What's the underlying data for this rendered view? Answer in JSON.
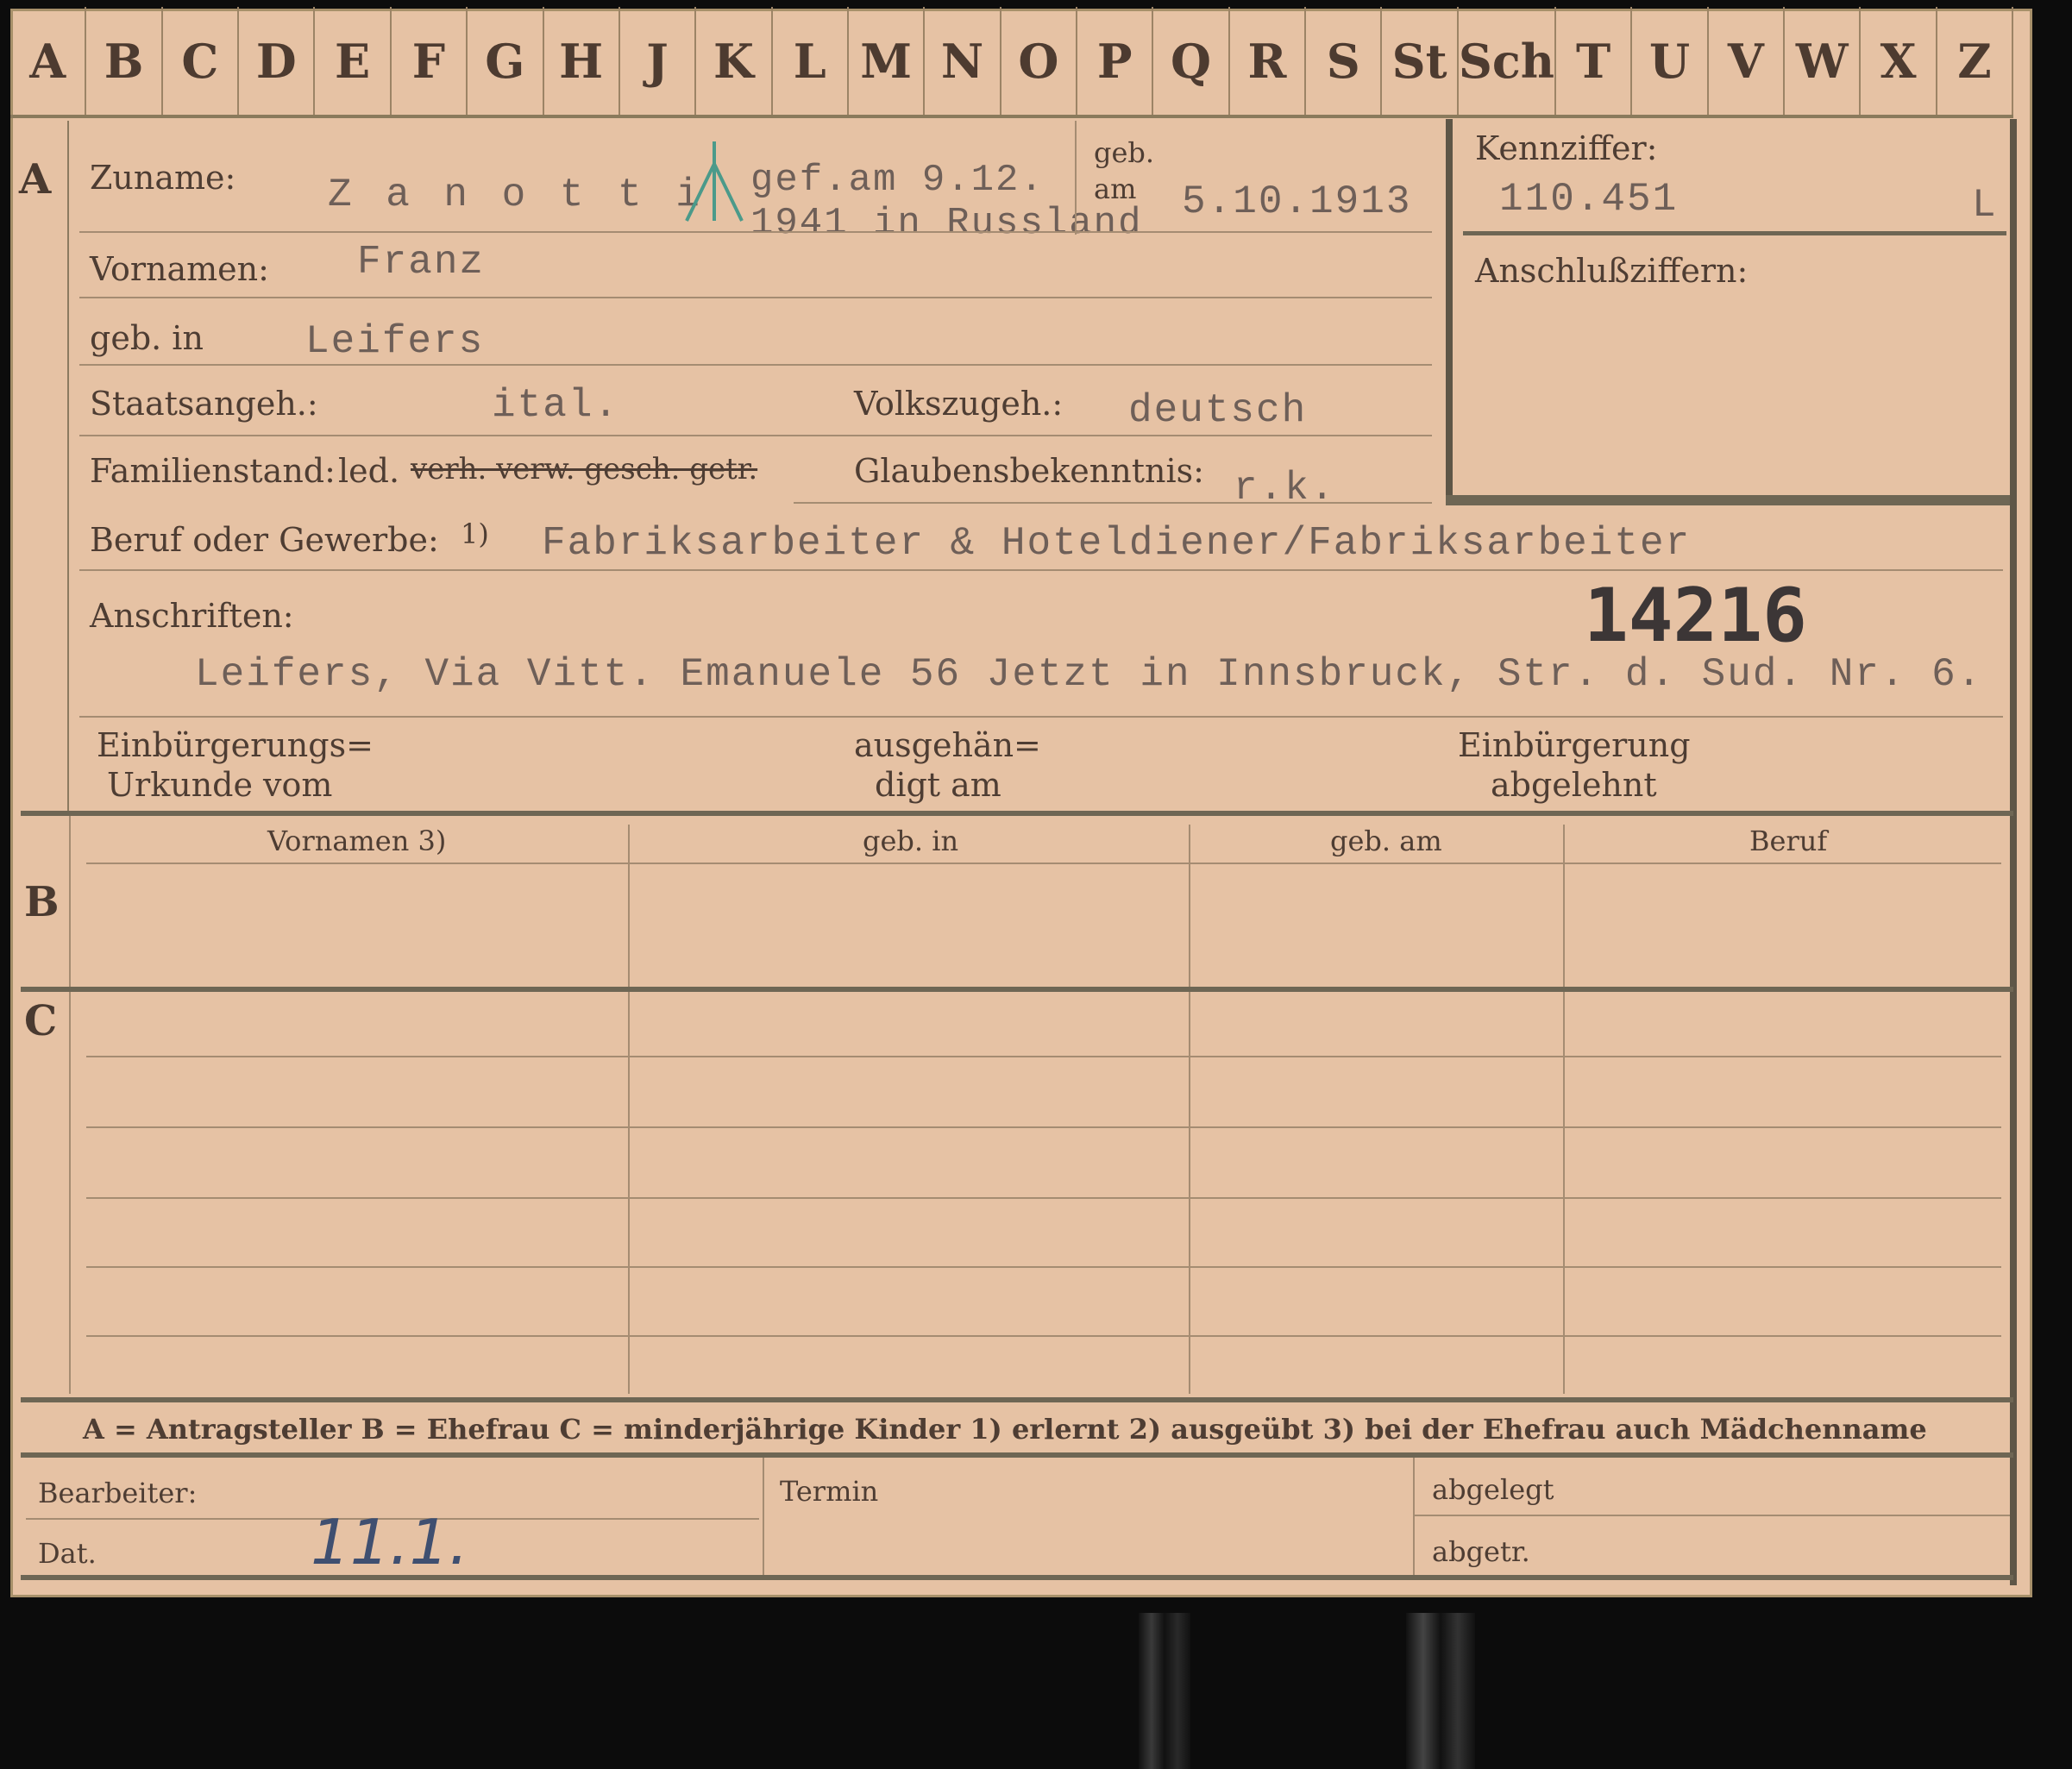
{
  "tabs": [
    "A",
    "B",
    "C",
    "D",
    "E",
    "F",
    "G",
    "H",
    "J",
    "K",
    "L",
    "M",
    "N",
    "O",
    "P",
    "Q",
    "R",
    "S",
    "St",
    "Sch",
    "T",
    "U",
    "V",
    "W",
    "X",
    "Z"
  ],
  "section_a": {
    "letter": "A",
    "zuname_label": "Zuname:",
    "zuname_value": "Z a n o t t i",
    "gefallen_1": "gef.am 9.12.",
    "gefallen_2": "1941 in Russland",
    "geb_am_label_1": "geb.",
    "geb_am_label_2": "am",
    "geb_am_value": "5.10.1913",
    "kennziffer_label": "Kennziffer:",
    "kennziffer_value": "110.451",
    "kennziffer_mark": "L",
    "anschluss_label": "Anschlußziffern:",
    "vornamen_label": "Vornamen:",
    "vornamen_value": "Franz",
    "geb_in_label": "geb. in",
    "geb_in_value": "Leifers",
    "staat_label": "Staatsangeh.:",
    "staat_value": "ital.",
    "volk_label": "Volkszugeh.:",
    "volk_value": "deutsch",
    "familienstand_label": "Familienstand:",
    "familienstand_value": "led.",
    "familienstand_struck": "verh. verw. gesch. getr.",
    "glaube_label": "Glaubensbekenntnis:",
    "glaube_value": "r.k.",
    "beruf_label": "Beruf oder Gewerbe:",
    "beruf_note": "1)",
    "beruf_value": "Fabriksarbeiter & Hoteldiener/Fabriksarbeiter",
    "anschriften_label": "Anschriften:",
    "stamp_number": "14216",
    "anschrift_value": "Leifers, Via Vitt. Emanuele 56 Jetzt in Innsbruck, Str. d. Sud. Nr. 6.",
    "einb_urkunde_1": "Einbürgerungs=",
    "einb_urkunde_2": "Urkunde vom",
    "ausgehaendigt_1": "ausgehän=",
    "ausgehaendigt_2": "digt am",
    "einb_abgelehnt_1": "Einbürgerung",
    "einb_abgelehnt_2": "abgelehnt"
  },
  "section_b": {
    "letter": "B",
    "headers": [
      "Vornamen 3)",
      "geb. in",
      "geb. am",
      "Beruf"
    ]
  },
  "section_c": {
    "letter": "C"
  },
  "legend": "A = Antragsteller   B = Ehefrau   C = minderjährige Kinder   1) erlernt   2) ausgeübt   3) bei der Ehefrau auch Mädchenname",
  "footer": {
    "bearbeiter_label": "Bearbeiter:",
    "dat_label": "Dat.",
    "dat_value": "11.1.",
    "termin_label": "Termin",
    "abgelegt_label": "abgelegt",
    "abgetr_label": "abgetr."
  },
  "colors": {
    "card": "#e6c2a4",
    "ink": "#4e3d33",
    "typewriter": "#6e5f58",
    "pencil": "#3f4f70"
  }
}
